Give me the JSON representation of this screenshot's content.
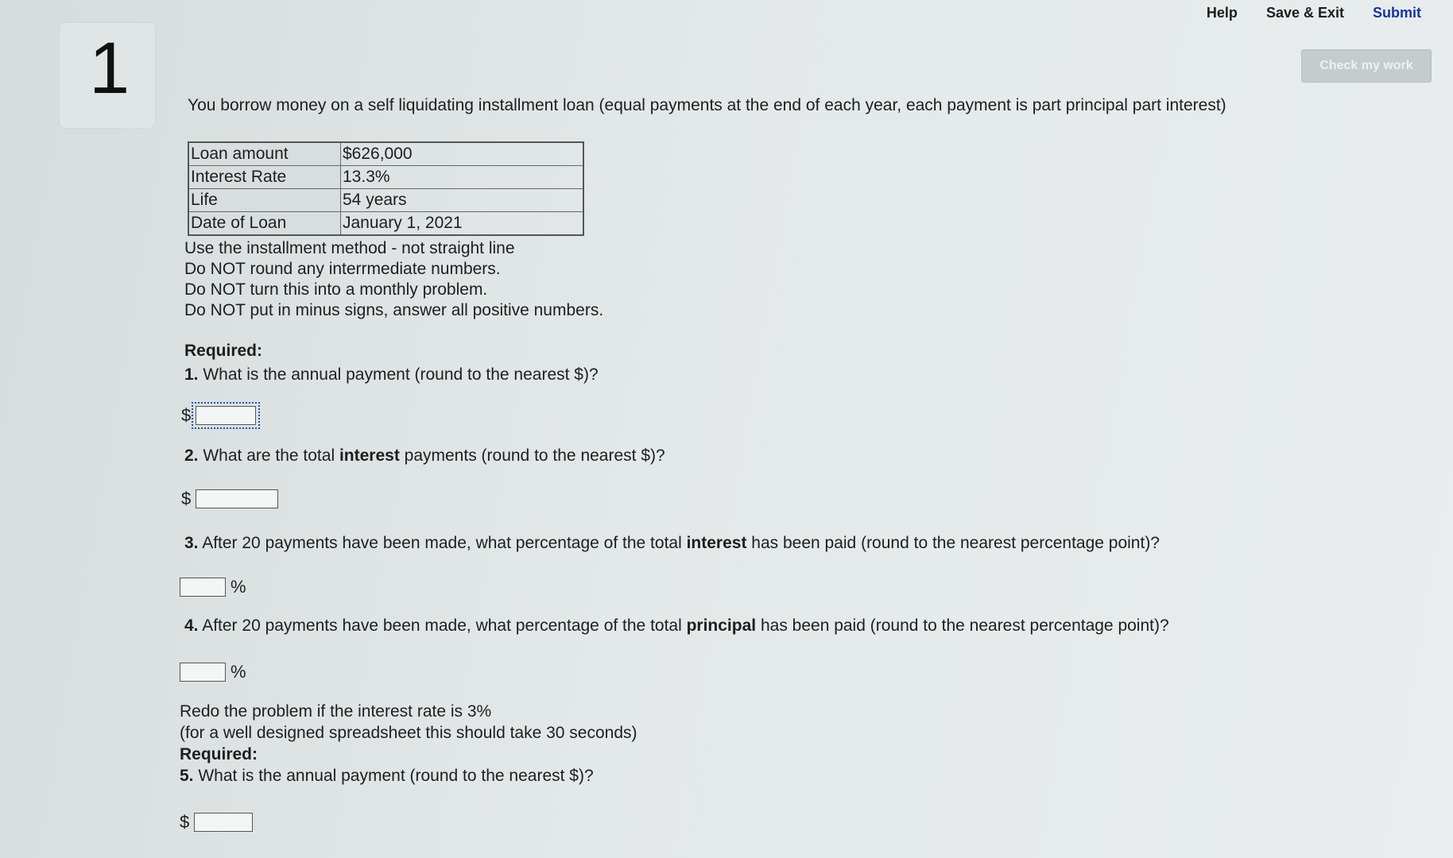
{
  "nav": {
    "help": "Help",
    "save_exit": "Save & Exit",
    "submit": "Submit"
  },
  "check_button": "Check my work",
  "question_number": "1",
  "intro": "You borrow money on a self liquidating installment loan (equal payments at the end of each year, each payment is part principal part interest)",
  "loan_table": [
    {
      "label": "Loan amount",
      "value": "$626,000"
    },
    {
      "label": "Interest Rate",
      "value": "13.3%"
    },
    {
      "label": "Life",
      "value": "54 years"
    },
    {
      "label": "Date of Loan",
      "value": "January 1, 2021"
    }
  ],
  "notes": [
    "Use the installment method - not straight line",
    "Do NOT round any interrmediate numbers.",
    "Do NOT turn this into a monthly problem.",
    "Do NOT put in minus signs, answer all positive numbers."
  ],
  "required_label": "Required:",
  "questions": [
    {
      "num": "1.",
      "text": "What is the annual payment (round to the nearest $)?",
      "prefix": "$",
      "suffix": ""
    },
    {
      "num": "2.",
      "pre": "What are the total ",
      "bold": "interest",
      "post": " payments (round to the nearest $)?",
      "prefix": "$",
      "suffix": ""
    },
    {
      "num": "3.",
      "pre": " After 20 payments have been made, what percentage of the total ",
      "bold": "interest",
      "post": " has been paid (round to the nearest percentage point)?",
      "prefix": "",
      "suffix": "%"
    },
    {
      "num": "4.",
      "pre": "After 20 payments have been made, what percentage of the total ",
      "bold": "principal",
      "post": " has been paid (round to the nearest percentage point)?",
      "prefix": "",
      "suffix": "%"
    }
  ],
  "redo": {
    "line1": "Redo the problem if the interest rate is 3%",
    "line2": "(for a well designed spreadsheet this should take 30 seconds)",
    "required": "Required:",
    "q5_num": "5.",
    "q5_text": "What is the annual payment (round to the nearest $)?",
    "q5_prefix": "$"
  }
}
